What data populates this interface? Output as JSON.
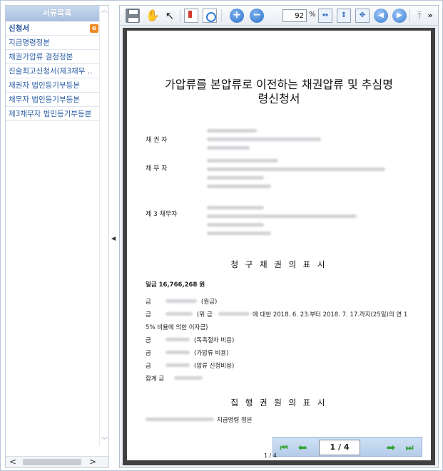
{
  "sidebar": {
    "header": "서류목록",
    "items": [
      {
        "label": "신청서",
        "active": true
      },
      {
        "label": "지급명령정본"
      },
      {
        "label": "채권가압류 결정정본"
      },
      {
        "label": "진술최고신청서(제3채무 .."
      },
      {
        "label": "채권자 법인등기부등본"
      },
      {
        "label": "채무자 법인등기부등본"
      },
      {
        "label": "제3채무자 법인등기부등본"
      }
    ],
    "edit_icon": "edit-icon",
    "scroll_left": "<",
    "scroll_right": ">"
  },
  "toolbar": {
    "zoom_value": "92",
    "zoom_unit": "%",
    "icons": [
      "print-icon",
      "hand-icon",
      "select-text-icon",
      "bookmark-icon",
      "thumbnail-icon",
      "zoom-in-icon",
      "zoom-out-icon",
      "fit-width-icon",
      "fit-height-icon",
      "fit-page-icon",
      "prev-view-icon",
      "next-view-icon",
      "top-icon",
      "more-icon"
    ]
  },
  "document": {
    "title_line1": "가압류를 본압류로 이전하는 채권압류 및 추심명",
    "title_line2": "령신청서",
    "parties": [
      {
        "label": "채 권 자"
      },
      {
        "label": "채 무 자"
      },
      {
        "label": "제 3 채무자"
      }
    ],
    "claim_section_title": "청 구 채 권 의  표 시",
    "claim_total": "일금 16,766,268 원",
    "claim_lines": [
      {
        "prefix": "금",
        "text": "(원금)"
      },
      {
        "prefix": "금",
        "text": "(위 금",
        "text2": "에 대한 2018.  6.  23.부터 2018.  7.  17.까지(25일)의 연 1"
      },
      {
        "text": "5% 비율에 의한 이자금)"
      },
      {
        "prefix": "금",
        "text": "(독촉절차 비용)"
      },
      {
        "prefix": "금",
        "text": "(가압류 비용)"
      },
      {
        "prefix": "금",
        "text": "(압류 신청비용)"
      },
      {
        "prefix": "합계  금"
      }
    ],
    "enforcement_section_title": "집 행 권 원 의  표 시",
    "enforcement_text": "지급명령 정본"
  },
  "pager": {
    "current": "1",
    "total": "4",
    "display": "1 / 4",
    "footer": "1 / 4"
  },
  "colors": {
    "sidebar_header": "#a9c1e2",
    "link": "#2c5fa8",
    "doc_background": "#404040",
    "pager_background": "#b5cce9",
    "nav_arrow": "#2fa52f"
  }
}
